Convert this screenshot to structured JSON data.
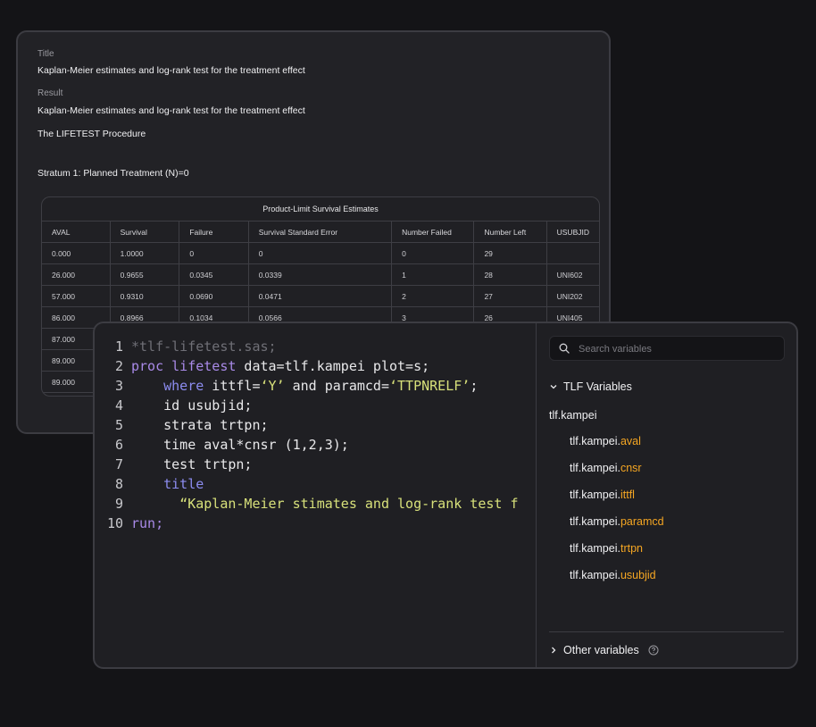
{
  "back": {
    "title_label": "Title",
    "title_value": "Kaplan-Meier estimates and log-rank test for the treatment effect",
    "result_label": "Result",
    "result_value": "Kaplan-Meier estimates and log-rank test for the treatment effect",
    "procedure": "The LIFETEST Procedure",
    "stratum": "Stratum 1: Planned Treatment (N)=0",
    "table": {
      "title": "Product-Limit Survival Estimates",
      "columns": [
        "AVAL",
        "Survival",
        "Failure",
        "Survival Standard Error",
        "Number Failed",
        "Number Left",
        "USUBJID"
      ],
      "rows": [
        [
          "0.000",
          "1.0000",
          "0",
          "0",
          "0",
          "29",
          ""
        ],
        [
          "26.000",
          "0.9655",
          "0.0345",
          "0.0339",
          "1",
          "28",
          "UNI602"
        ],
        [
          "57.000",
          "0.9310",
          "0.0690",
          "0.0471",
          "2",
          "27",
          "UNI202"
        ],
        [
          "86.000",
          "0.8966",
          "0.1034",
          "0.0566",
          "3",
          "26",
          "UNI405"
        ],
        [
          "87.000",
          "",
          "",
          "",
          "",
          "",
          ""
        ],
        [
          "89.000",
          "",
          "",
          "",
          "",
          "",
          ""
        ],
        [
          "89.000",
          "",
          "",
          "",
          "",
          "",
          ""
        ]
      ]
    }
  },
  "editor": {
    "lines": [
      {
        "n": "1",
        "indent": "",
        "tokens": [
          {
            "t": "*tlf-lifetest.sas;",
            "c": "comment"
          }
        ]
      },
      {
        "n": "2",
        "indent": "",
        "tokens": [
          {
            "t": "proc lifetest",
            "c": "kw2"
          },
          {
            "t": " data=tlf.kampei plot=s;",
            "c": "plain"
          }
        ]
      },
      {
        "n": "3",
        "indent": "    ",
        "tokens": [
          {
            "t": "where",
            "c": "kw"
          },
          {
            "t": " ittfl=",
            "c": "plain"
          },
          {
            "t": "‘Y’",
            "c": "str"
          },
          {
            "t": " and paramcd=",
            "c": "plain"
          },
          {
            "t": "‘TTPNRELF’",
            "c": "str"
          },
          {
            "t": ";",
            "c": "plain"
          }
        ]
      },
      {
        "n": "4",
        "indent": "    ",
        "tokens": [
          {
            "t": "id usubjid;",
            "c": "plain"
          }
        ]
      },
      {
        "n": "5",
        "indent": "    ",
        "tokens": [
          {
            "t": "strata trtpn;",
            "c": "plain"
          }
        ]
      },
      {
        "n": "6",
        "indent": "    ",
        "tokens": [
          {
            "t": "time aval*cnsr (1,2,3);",
            "c": "plain"
          }
        ]
      },
      {
        "n": "7",
        "indent": "    ",
        "tokens": [
          {
            "t": "test trtpn;",
            "c": "plain"
          }
        ]
      },
      {
        "n": "8",
        "indent": "    ",
        "tokens": [
          {
            "t": "title",
            "c": "kw"
          }
        ]
      },
      {
        "n": "9",
        "indent": "      ",
        "tokens": [
          {
            "t": "“Kaplan-Meier stimates and log-rank test f",
            "c": "str"
          }
        ]
      },
      {
        "n": "10",
        "indent": "",
        "tokens": [
          {
            "t": "run;",
            "c": "kw2"
          }
        ]
      }
    ]
  },
  "sidebar": {
    "search_placeholder": "Search variables",
    "section_title": "TLF Variables",
    "group": "tlf.kampei",
    "variables": [
      {
        "prefix": "tlf.kampei.",
        "field": "aval"
      },
      {
        "prefix": "tlf.kampei.",
        "field": "cnsr"
      },
      {
        "prefix": "tlf.kampei.",
        "field": "ittfl"
      },
      {
        "prefix": "tlf.kampei.",
        "field": "paramcd"
      },
      {
        "prefix": "tlf.kampei.",
        "field": "trtpn"
      },
      {
        "prefix": "tlf.kampei.",
        "field": "usubjid"
      }
    ],
    "other_label": "Other variables",
    "colors": {
      "field": "#f5a623",
      "keyword": "#8c8cf0",
      "string": "#d7e07a"
    }
  }
}
